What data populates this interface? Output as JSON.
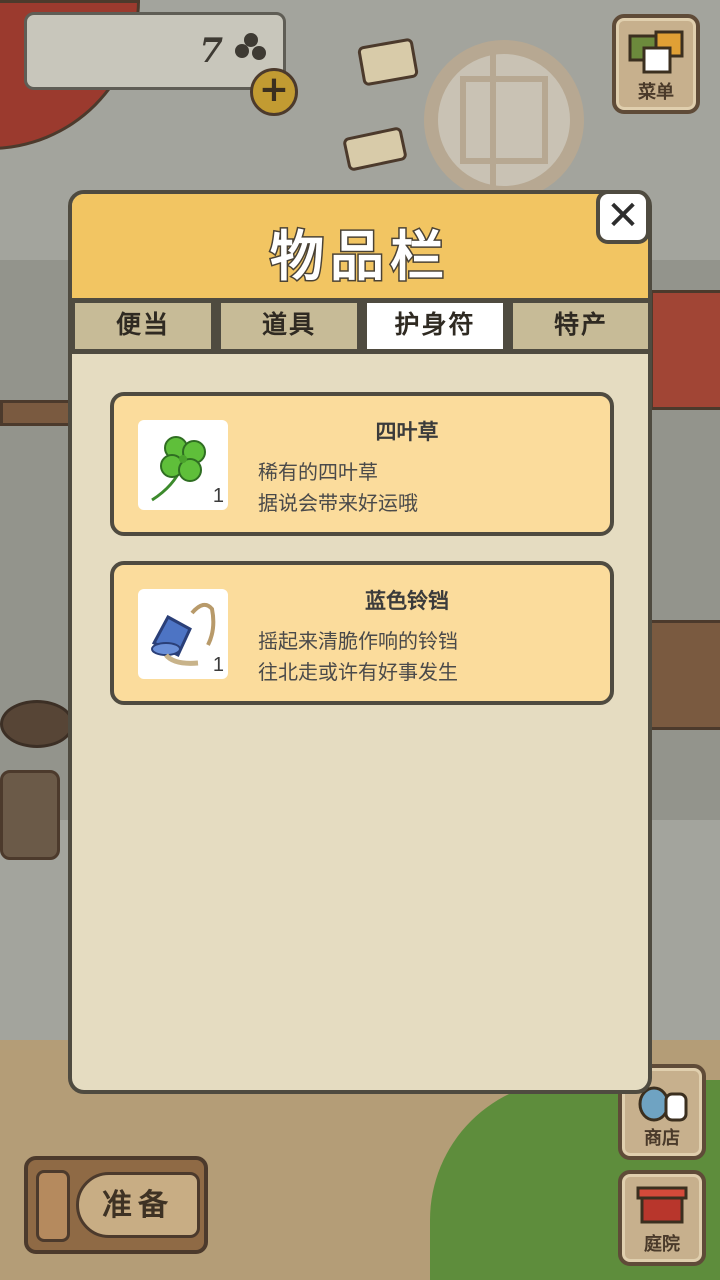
{
  "hud": {
    "clover_count": "7",
    "plus_label": "+",
    "menu_label": "菜单",
    "shop_label": "商店",
    "garden_label": "庭院",
    "prepare_label": "准备"
  },
  "inventory": {
    "title": "物品栏",
    "close_label": "✕",
    "tabs": [
      {
        "label": "便当",
        "active": false
      },
      {
        "label": "道具",
        "active": false
      },
      {
        "label": "护身符",
        "active": true
      },
      {
        "label": "特产",
        "active": false
      }
    ],
    "items": [
      {
        "name": "四叶草",
        "quantity": "1",
        "icon": "four-leaf-clover-icon",
        "description": [
          "稀有的四叶草",
          "据说会带来好运哦"
        ]
      },
      {
        "name": "蓝色铃铛",
        "quantity": "1",
        "icon": "blue-bell-icon",
        "description": [
          "摇起来清脆作响的铃铛",
          "往北走或许有好事发生"
        ]
      }
    ]
  },
  "colors": {
    "header": "#f2c562",
    "panel": "#e5dcc1",
    "card": "#fbdc9c",
    "border": "#4f4b40"
  }
}
